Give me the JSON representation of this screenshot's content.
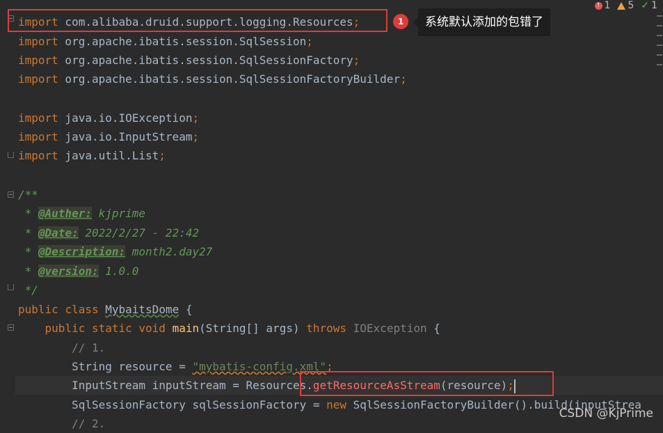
{
  "status": {
    "errors": "1",
    "warnings": "5",
    "checks": "1"
  },
  "annotation": {
    "badge": "1",
    "tooltip": "系统默认添加的包错了"
  },
  "code": {
    "l1": {
      "kw": "import",
      "rest": " com.alibaba.druid.support.logging.Resources",
      "semi": ";"
    },
    "l2": {
      "kw": "import",
      "rest": " org.apache.ibatis.session.SqlSession",
      "semi": ";"
    },
    "l3": {
      "kw": "import",
      "rest": " org.apache.ibatis.session.SqlSessionFactory",
      "semi": ";"
    },
    "l4": {
      "kw": "import",
      "rest": " org.apache.ibatis.session.SqlSessionFactoryBuilder",
      "semi": ";"
    },
    "l6": {
      "kw": "import",
      "rest": " java.io.IOException",
      "semi": ";"
    },
    "l7": {
      "kw": "import",
      "rest": " java.io.InputStream",
      "semi": ";"
    },
    "l8": {
      "kw": "import",
      "rest": " java.util.List",
      "semi": ";"
    },
    "l10": "/**",
    "l11": {
      "star": " * ",
      "tag": "@Auther:",
      "val": " kjprime"
    },
    "l12": {
      "star": " * ",
      "tag": "@Date:",
      "val": " 2022/2/27 - 22:42"
    },
    "l13": {
      "star": " * ",
      "tag": "@Description:",
      "val": " month2.day27"
    },
    "l14": {
      "star": " * ",
      "tag": "@version:",
      "val": " 1.0.0"
    },
    "l15": " */",
    "l16": {
      "kw1": "public",
      "kw2": "class",
      "name": "MybaitsDome",
      "rest": " {"
    },
    "l17": {
      "kw": "public static void",
      "fn": "main",
      "args": "(String[] args) ",
      "throws": "throws",
      "exc": " IOException",
      "rest": " {"
    },
    "l18": "// 1.",
    "l19": {
      "a": "String resource = ",
      "str": "\"mybatis-config.xml\"",
      "semi": ";"
    },
    "l20": {
      "a": "InputStream inputStream = Resources.",
      "err": "getResourceAsStream",
      "b": "(resource)",
      "semi": ";"
    },
    "l21": {
      "a": "SqlSessionFactory sqlSessionFactory = ",
      "kw": "new",
      "b": " SqlSessionFactoryBuilder().build(inputStrea"
    },
    "l22": "// 2."
  },
  "watermark": "CSDN @KjPrime"
}
